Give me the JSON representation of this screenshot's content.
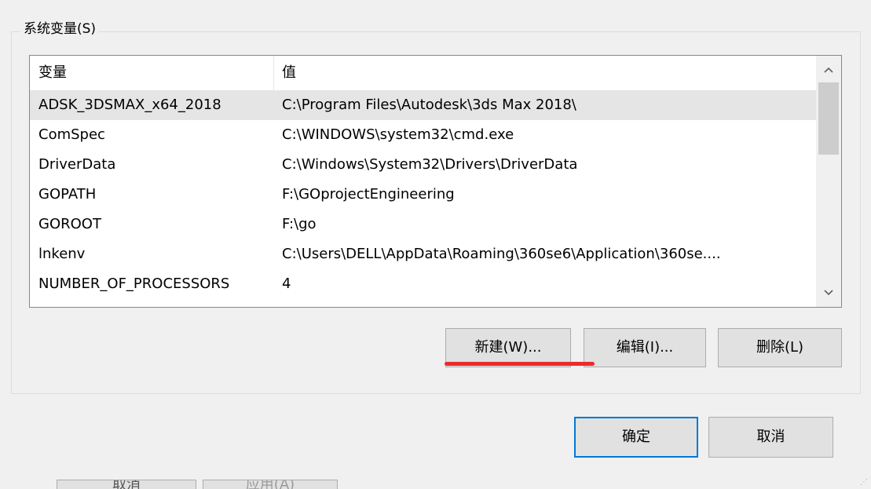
{
  "group": {
    "label": "系统变量(S)"
  },
  "listview": {
    "columns": [
      "变量",
      "值"
    ],
    "rows": [
      {
        "name": "ADSK_3DSMAX_x64_2018",
        "value": "C:\\Program Files\\Autodesk\\3ds Max 2018\\",
        "selected": true
      },
      {
        "name": "ComSpec",
        "value": "C:\\WINDOWS\\system32\\cmd.exe"
      },
      {
        "name": "DriverData",
        "value": "C:\\Windows\\System32\\Drivers\\DriverData"
      },
      {
        "name": "GOPATH",
        "value": "F:\\GOprojectEngineering"
      },
      {
        "name": "GOROOT",
        "value": "F:\\go"
      },
      {
        "name": "lnkenv",
        "value": "C:\\Users\\DELL\\AppData\\Roaming\\360se6\\Application\\360se...."
      },
      {
        "name": "NUMBER_OF_PROCESSORS",
        "value": "4"
      }
    ],
    "scroll_up_icon": "chevron-up-icon",
    "scroll_down_icon": "chevron-down-icon"
  },
  "buttons": {
    "new": "新建(W)...",
    "edit": "编辑(I)...",
    "delete": "删除(L)",
    "ok": "确定",
    "cancel": "取消"
  },
  "annotation": {
    "color": "#ec2a2a"
  },
  "background_dialog": {
    "buttons": [
      "取消",
      "应用(A)"
    ]
  },
  "colors": {
    "accent": "#0078d7",
    "selected_row": "#e5e5e5",
    "dialog_bg": "#f0f0f0"
  }
}
